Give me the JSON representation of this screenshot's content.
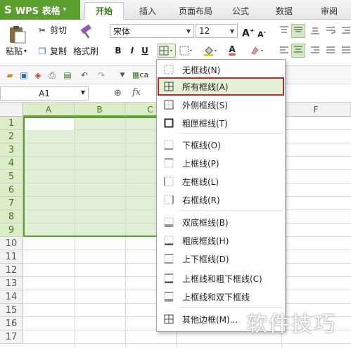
{
  "app": {
    "logo": "S",
    "name": "WPS 表格",
    "dropdown": "▾"
  },
  "tabs": [
    {
      "label": "开始",
      "active": true
    },
    {
      "label": "插入",
      "active": false
    },
    {
      "label": "页面布局",
      "active": false
    },
    {
      "label": "公式",
      "active": false
    },
    {
      "label": "数据",
      "active": false
    },
    {
      "label": "审阅",
      "active": false
    }
  ],
  "ribbon": {
    "paste": "粘贴",
    "cut": "剪切",
    "copy": "复制",
    "format_painter": "格式刷",
    "font_name": "宋体",
    "font_size": "12",
    "bold": "B",
    "italic": "I",
    "underline": "U",
    "font_color_letter": "A"
  },
  "quickbar": {
    "doc_label": "ca"
  },
  "formula_bar": {
    "cell_ref": "A1",
    "fx": "fx"
  },
  "sheet": {
    "columns": [
      "A",
      "B",
      "C",
      "F"
    ],
    "rows": [
      "1",
      "2",
      "3",
      "4",
      "5",
      "6",
      "7",
      "8",
      "9",
      "10",
      "11",
      "12",
      "13",
      "14",
      "15",
      "16",
      "17"
    ]
  },
  "border_menu": {
    "items": [
      {
        "label": "无框线(N)",
        "icon": "no-border-icon"
      },
      {
        "label": "所有框线(A)",
        "icon": "all-borders-icon",
        "highlighted": true
      },
      {
        "label": "外侧框线(S)",
        "icon": "outside-borders-icon"
      },
      {
        "label": "粗匣框线(T)",
        "icon": "thick-box-border-icon"
      },
      {
        "label": "下框线(O)",
        "icon": "bottom-border-icon"
      },
      {
        "label": "上框线(P)",
        "icon": "top-border-icon"
      },
      {
        "label": "左框线(L)",
        "icon": "left-border-icon"
      },
      {
        "label": "右框线(R)",
        "icon": "right-border-icon"
      },
      {
        "label": "双底框线(B)",
        "icon": "double-bottom-border-icon"
      },
      {
        "label": "粗底框线(H)",
        "icon": "thick-bottom-border-icon"
      },
      {
        "label": "上下框线(D)",
        "icon": "top-bottom-border-icon"
      },
      {
        "label": "上框线和粗下框线(C)",
        "icon": "top-thick-bottom-border-icon"
      },
      {
        "label": "上框线和双下框线",
        "icon": "top-double-bottom-border-icon"
      },
      {
        "label": "其他边框(M)...",
        "icon": "more-borders-icon"
      }
    ]
  },
  "watermark": "软件技巧",
  "colors": {
    "accent": "#5a9e2d",
    "selection": "#dcedc8",
    "highlight_border": "#c0282c"
  }
}
